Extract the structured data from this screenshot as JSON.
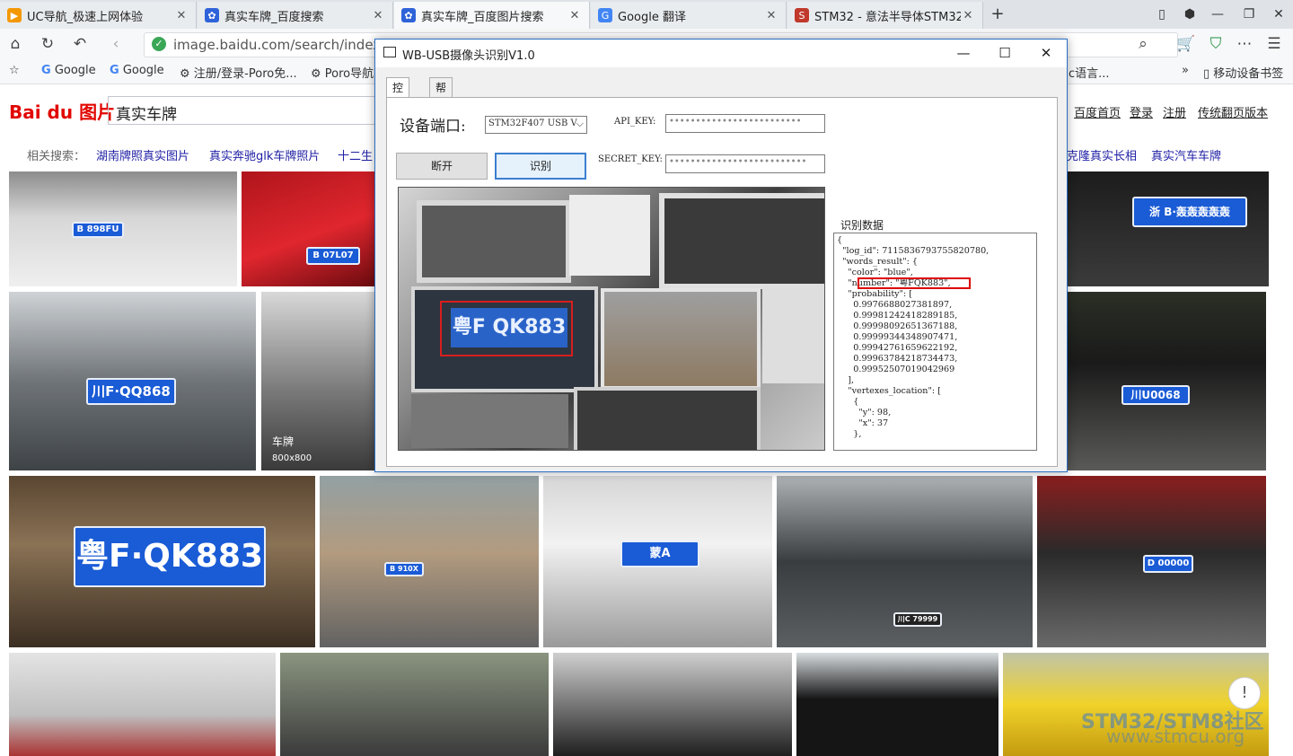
{
  "browser": {
    "tabs": [
      {
        "title": "UC导航_极速上网体验",
        "icon": "uc-icon",
        "color": "#f39800"
      },
      {
        "title": "真实车牌_百度搜索",
        "icon": "baidu-paw-icon",
        "color": "#2f63d9"
      },
      {
        "title": "真实车牌_百度图片搜索",
        "icon": "baidu-paw-icon",
        "color": "#2f63d9"
      },
      {
        "title": "Google 翻译",
        "icon": "google-translate-icon",
        "color": "#4285f4"
      },
      {
        "title": "STM32 - 意法半导体STM32/",
        "icon": "stm32-icon",
        "color": "#c0392b"
      }
    ],
    "url": "image.baidu.com/search/index?tn",
    "bookmarks": [
      "Google",
      "Google",
      "注册/登录-Poro免...",
      "Poro导航",
      "移动设备书签"
    ],
    "bookmark_right": "c语言..."
  },
  "baidu": {
    "logo": "Bai du 图片",
    "query": "真实车牌",
    "top_links": [
      "百度首页",
      "登录",
      "注册",
      "传统翻页版本"
    ],
    "related_label": "相关搜索：",
    "related": [
      "湖南牌照真实图片",
      "真实奔驰glk车牌照片",
      "十二生",
      "克隆真实长相",
      "真实汽车车牌"
    ],
    "tile_caption": "车牌",
    "tile_size": "800x800",
    "plates": [
      "B 898FU",
      "B 07L07",
      "川F·QQ868",
      "粤F·QK883",
      "B 910X",
      "蒙A",
      "川C 79999",
      "D 00000",
      "川U0068",
      "浙 B·轰轰轰轰轰"
    ]
  },
  "app": {
    "title": "WB-USB摄像头识别V1.0",
    "tabs": [
      "控制",
      "帮助"
    ],
    "port_label": "设备端口:",
    "port_value": "STM32F407 USB V",
    "api_key_label": "API_KEY:",
    "api_key_value": "•••••••••••••••••••••••••",
    "secret_key_label": "SECRET_KEY:",
    "secret_key_value": "••••••••••••••••••••••••••",
    "disconnect_button": "断开",
    "recognize_button": "识别",
    "result_label": "识别数据",
    "preview_plate": "粤F QK883",
    "json_lines": [
      "{",
      "  \"log_id\": 7115836793755820780,",
      "  \"words_result\": {",
      "    \"color\": \"blue\",",
      "    \"number\": \"粤FQK883\",",
      "    \"probability\": [",
      "      0.9976688027381897,",
      "      0.99981242418289185,",
      "      0.99998092651367188,",
      "      0.99999344348907471,",
      "      0.99942761659622192,",
      "      0.99963784218734473,",
      "      0.99952507019042969",
      "    ],",
      "    \"vertexes_location\": [",
      "      {",
      "        \"y\": 98,",
      "        \"x\": 37",
      "      },"
    ]
  },
  "watermark": {
    "line1": "STM32/STM8社区",
    "line2": "www.stmcu.org"
  }
}
